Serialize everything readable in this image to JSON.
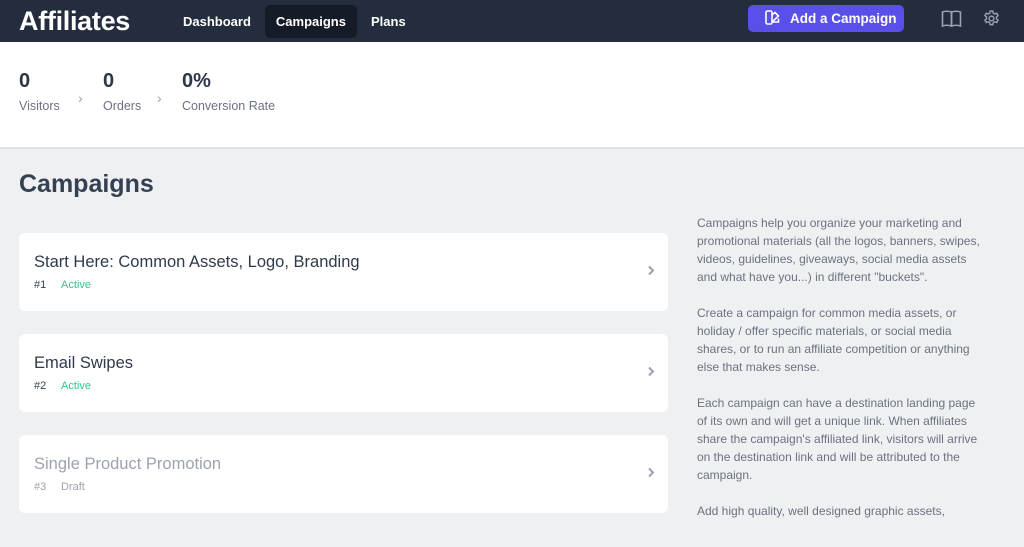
{
  "topbar": {
    "brand": "Affiliates",
    "nav": [
      {
        "label": "Dashboard",
        "active": false
      },
      {
        "label": "Campaigns",
        "active": true
      },
      {
        "label": "Plans",
        "active": false
      }
    ],
    "add_button_label": "Add a Campaign",
    "icons": {
      "add": "campaign-shapes-icon",
      "docs": "book-icon",
      "settings": "gear-icon"
    },
    "accent_color": "#5b4fe9"
  },
  "stats": [
    {
      "value": "0",
      "label": "Visitors"
    },
    {
      "value": "0",
      "label": "Orders"
    },
    {
      "value": "0%",
      "label": "Conversion Rate"
    }
  ],
  "page_title": "Campaigns",
  "campaigns": [
    {
      "title": "Start Here: Common Assets, Logo, Branding",
      "number": "#1",
      "status": "Active"
    },
    {
      "title": "Email Swipes",
      "number": "#2",
      "status": "Active"
    },
    {
      "title": "Single Product Promotion",
      "number": "#3",
      "status": "Draft"
    }
  ],
  "status_colors": {
    "Active": "#34c38f",
    "Draft": "#9ca3af"
  },
  "help": [
    "Campaigns help you organize your marketing and promotional materials (all the logos, banners, swipes, videos, guidelines, giveaways, social media assets and what have you...) in different \"buckets\".",
    "Create a campaign for common media assets, or holiday / offer specific materials, or social media shares, or to run an affiliate competition or anything else that makes sense.",
    "Each campaign can have a destination landing page of its own and will get a unique link. When affiliates share the campaign's affiliated link, visitors will arrive on the destination link and will be attributed to the campaign.",
    "Add high quality, well designed graphic assets,"
  ]
}
